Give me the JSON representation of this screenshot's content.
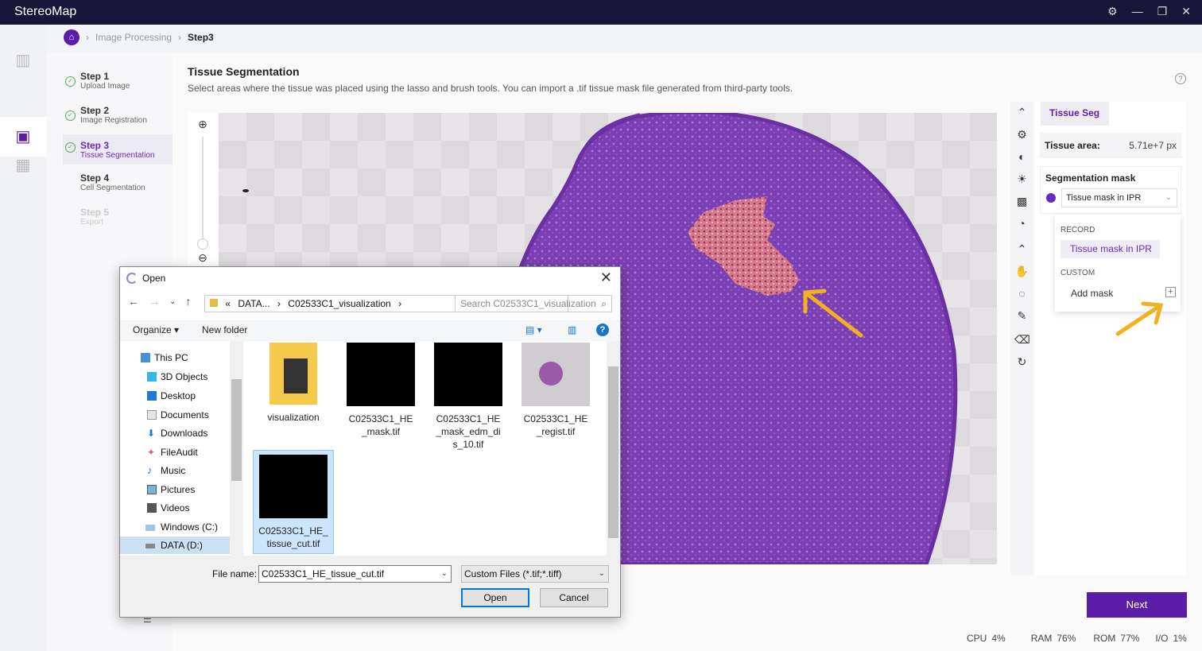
{
  "app": {
    "title": "StereoMap"
  },
  "breadcrumb": {
    "items": [
      "Image Processing",
      "Step3"
    ]
  },
  "steps": [
    {
      "title": "Step 1",
      "subtitle": "Upload Image",
      "state": "done"
    },
    {
      "title": "Step 2",
      "subtitle": "Image Registration",
      "state": "done"
    },
    {
      "title": "Step 3",
      "subtitle": "Tissue Segmentation",
      "state": "active"
    },
    {
      "title": "Step 4",
      "subtitle": "Cell Segmentation",
      "state": "pending"
    },
    {
      "title": "Step 5",
      "subtitle": "Export",
      "state": "disabled"
    }
  ],
  "page": {
    "title": "Tissue Segmentation",
    "description": "Select areas where the tissue was placed using the lasso and brush tools. You can import a .tif tissue mask file generated from third-party tools."
  },
  "right_panel": {
    "tab": "Tissue Seg",
    "tissue_area_label": "Tissue area:",
    "tissue_area_value": "5.71e+7 px",
    "mask_label": "Segmentation mask",
    "mask_selected": "Tissue mask in IPR",
    "popover": {
      "record_header": "RECORD",
      "record_item": "Tissue mask in IPR",
      "custom_header": "CUSTOM",
      "add_mask": "Add mask"
    }
  },
  "next_button": "Next",
  "status": {
    "cpu_label": "CPU",
    "cpu": "4%",
    "ram_label": "RAM",
    "ram": "76%",
    "rom_label": "ROM",
    "rom": "77%",
    "io_label": "I/O",
    "io": "1%"
  },
  "dialog": {
    "title": "Open",
    "address": {
      "prefix": "«",
      "path1": "DATA...",
      "path2": "C02533C1_visualization"
    },
    "search_placeholder": "Search C02533C1_visualization",
    "organize": "Organize",
    "new_folder": "New folder",
    "tree": [
      "This PC",
      "3D Objects",
      "Desktop",
      "Documents",
      "Downloads",
      "FileAudit",
      "Music",
      "Pictures",
      "Videos",
      "Windows (C:)",
      "DATA (D:)"
    ],
    "files": [
      {
        "name": "visualization",
        "kind": "folder"
      },
      {
        "name": "C02533C1_HE_mask.tif",
        "kind": "black"
      },
      {
        "name": "C02533C1_HE_mask_edm_dis_10.tif",
        "kind": "black"
      },
      {
        "name": "C02533C1_HE_regist.tif",
        "kind": "tissue"
      },
      {
        "name": "C02533C1_HE_tissue_cut.tif",
        "kind": "black"
      }
    ],
    "file_name_label": "File name:",
    "file_name_value": "C02533C1_HE_tissue_cut.tif",
    "file_type": "Custom Files (*.tif;*.tiff)",
    "open_button": "Open",
    "cancel_button": "Cancel"
  },
  "colors": {
    "brand": "#5a1ea8",
    "titlebar": "#171538",
    "tissue": "#7a3db0",
    "arrow": "#f2b21f"
  }
}
